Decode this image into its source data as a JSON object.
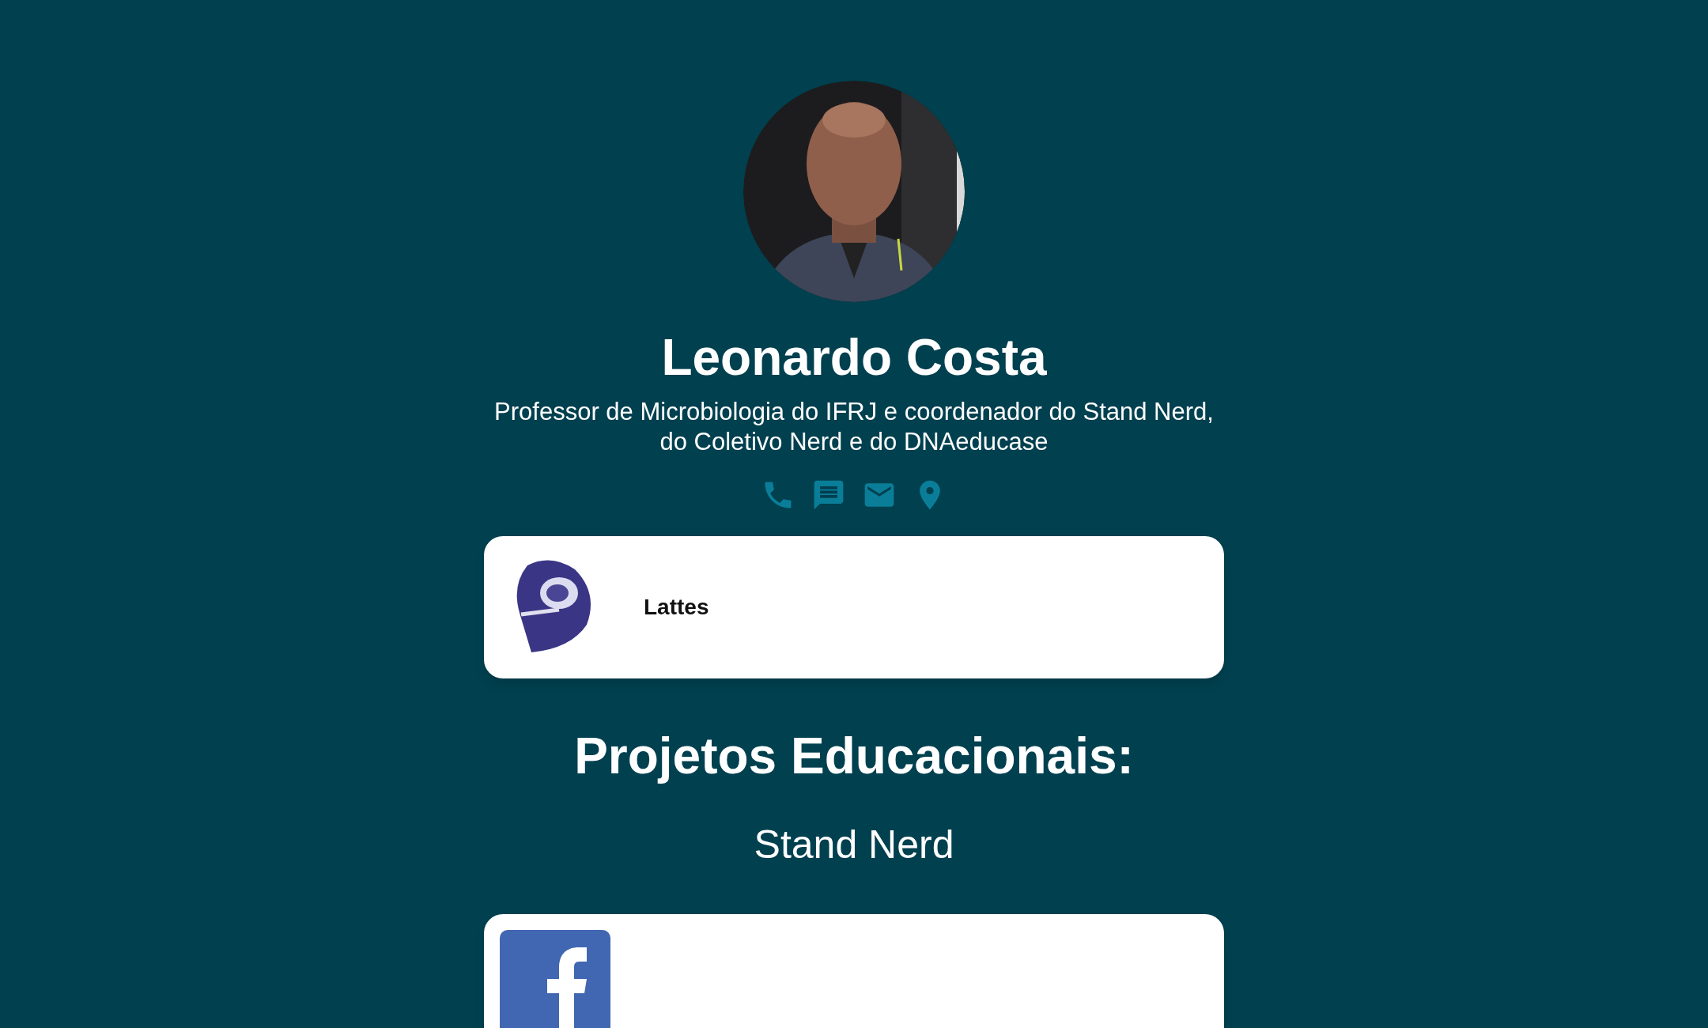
{
  "profile": {
    "name": "Leonardo Costa",
    "bio": "Professor de Microbiologia do IFRJ e coordenador do Stand Nerd, do Coletivo Nerd e do DNAeducase"
  },
  "links": [
    {
      "kind": "lattes",
      "label": "Lattes"
    }
  ],
  "section": {
    "heading": "Projetos Educacionais:",
    "subheading": "Stand Nerd",
    "links": [
      {
        "kind": "facebook"
      }
    ]
  }
}
